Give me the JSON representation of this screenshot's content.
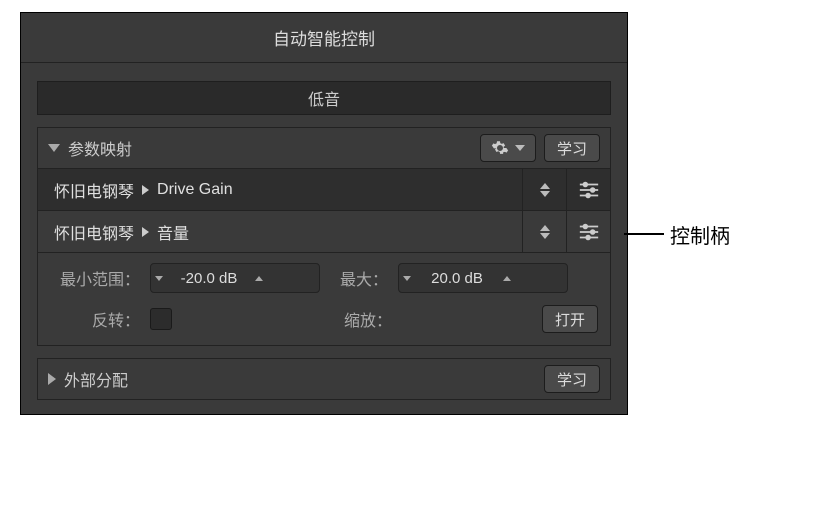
{
  "title": "自动智能控制",
  "control_name": "低音",
  "sections": {
    "mapping": {
      "label": "参数映射",
      "learn_btn": "学习",
      "rows": [
        {
          "instrument": "怀旧电钢琴",
          "param": "Drive Gain"
        },
        {
          "instrument": "怀旧电钢琴",
          "param": "音量"
        }
      ],
      "min_label": "最小范围：",
      "min_value": "-20.0 dB",
      "max_label": "最大：",
      "max_value": "20.0 dB",
      "invert_label": "反转：",
      "scale_label": "缩放：",
      "open_btn": "打开"
    },
    "external": {
      "label": "外部分配",
      "learn_btn": "学习"
    }
  },
  "callout": "控制柄"
}
